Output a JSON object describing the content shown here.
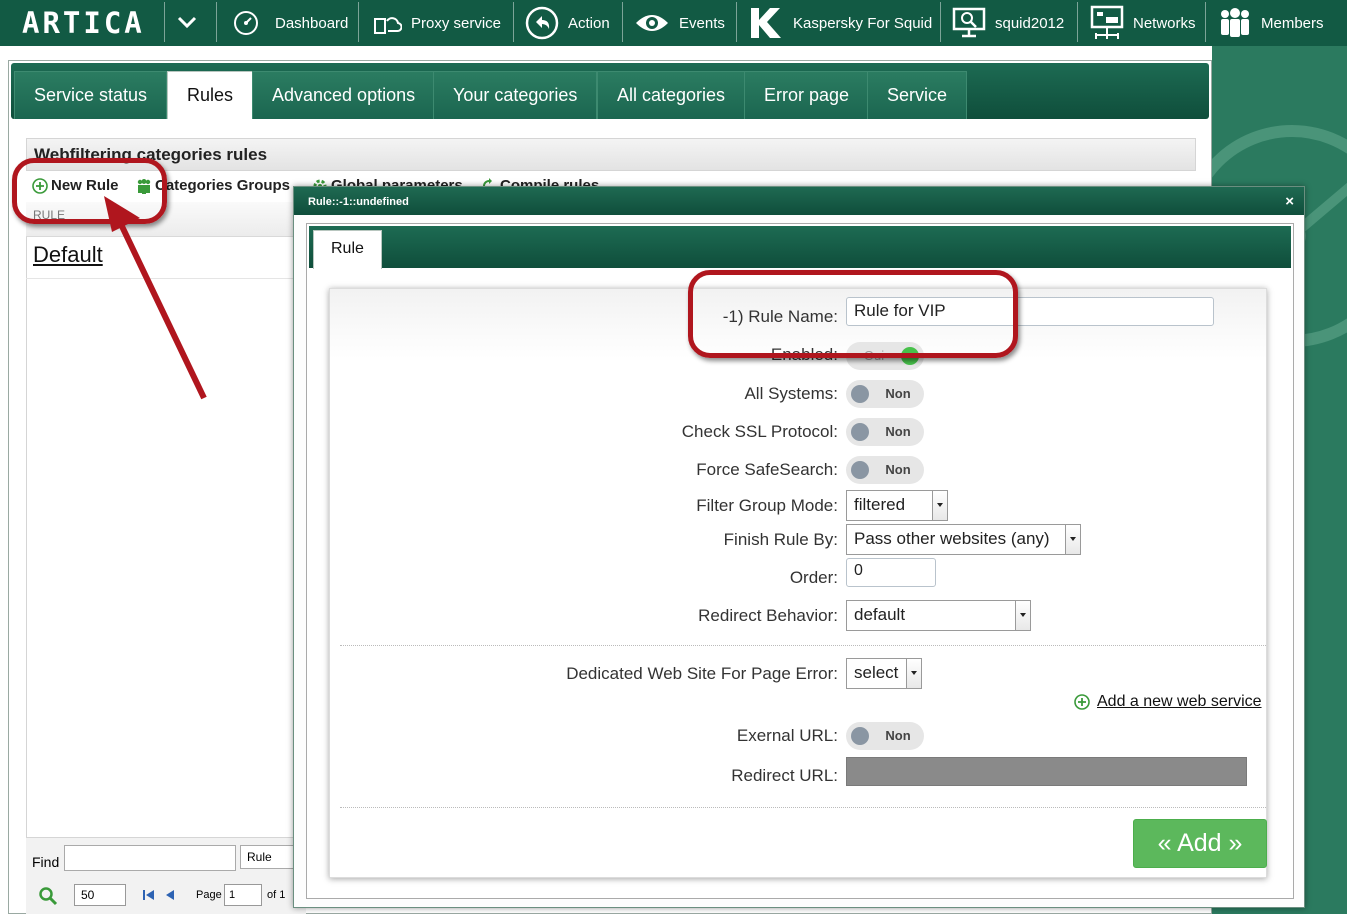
{
  "topbar": {
    "logo": "ARTICA",
    "nav": [
      {
        "label": "Dashboard",
        "icon": "dashboard-icon"
      },
      {
        "label": "Proxy service",
        "icon": "proxy-icon"
      },
      {
        "label": "Action",
        "icon": "action-icon"
      },
      {
        "label": "Events",
        "icon": "eye-icon"
      },
      {
        "label": "Kaspersky For Squid",
        "icon": "kaspersky-icon"
      },
      {
        "label": "squid2012",
        "icon": "monitor-icon"
      },
      {
        "label": "Networks",
        "icon": "networks-icon"
      },
      {
        "label": "Members",
        "icon": "members-icon"
      }
    ]
  },
  "tabs": [
    "Service status",
    "Rules",
    "Advanced options",
    "Your categories",
    "All categories",
    "Error page",
    "Service"
  ],
  "active_tab": "Rules",
  "grid": {
    "title": "Webfiltering categories rules",
    "toolbar": {
      "new_rule": "New Rule",
      "categories_groups": "Categories Groups",
      "global_parameters": "Global parameters",
      "compile_rules": "Compile rules"
    },
    "column_header": "RULE",
    "rows": [
      "Default"
    ],
    "find_label": "Find",
    "find_field": "Rule",
    "page_size": "50",
    "page_label": "Page",
    "page_value": "1",
    "page_of": "of 1"
  },
  "modal": {
    "title": "Rule::-1::undefined",
    "close": "×",
    "tab": "Rule",
    "fields": {
      "rule_name_label": "-1) Rule Name:",
      "rule_name_value": "Rule for VIP",
      "enabled_label": "Enabled:",
      "enabled_value": "Oui",
      "all_systems_label": "All Systems:",
      "all_systems_value": "Non",
      "ssl_label": "Check SSL Protocol:",
      "ssl_value": "Non",
      "safesearch_label": "Force SafeSearch:",
      "safesearch_value": "Non",
      "filter_mode_label": "Filter Group Mode:",
      "filter_mode_value": "filtered",
      "finish_label": "Finish Rule By:",
      "finish_value": "Pass other websites (any)",
      "order_label": "Order:",
      "order_value": "0",
      "redirect_behavior_label": "Redirect Behavior:",
      "redirect_behavior_value": "default",
      "dedicated_label": "Dedicated Web Site For Page Error:",
      "dedicated_value": "select",
      "add_web_service": "Add a new web service",
      "external_url_label": "Exernal URL:",
      "external_url_value": "Non",
      "redirect_url_label": "Redirect URL:"
    },
    "add_button": "« Add »"
  },
  "colors": {
    "brand_green": "#125a44",
    "annotation_red": "#b0161e",
    "add_button": "#5cb85c",
    "toggle_on": "#47c14a"
  }
}
